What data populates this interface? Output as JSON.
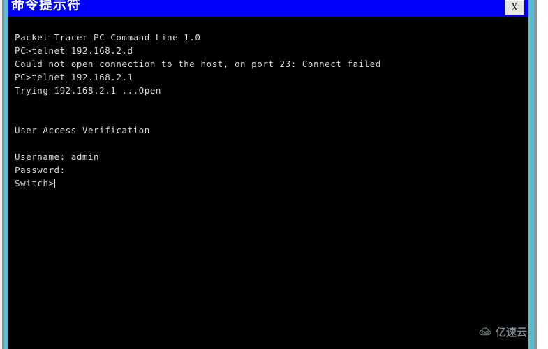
{
  "window": {
    "title": "命令提示符",
    "close_button_label": "X",
    "close_button_icon": "close-icon",
    "titlebar_color": "#0000ff",
    "border_color": "#5bbfd4",
    "console_background": "#000000",
    "console_text_color": "#d8d8d8"
  },
  "console": {
    "lines": [
      "Packet Tracer PC Command Line 1.0",
      "PC>telnet 192.168.2.d",
      "Could not open connection to the host, on port 23: Connect failed",
      "PC>telnet 192.168.2.1",
      "Trying 192.168.2.1 ...Open",
      "",
      "",
      "User Access Verification",
      "",
      "Username: admin",
      "Password:",
      "Switch>"
    ],
    "prompt_line": "Switch>",
    "cursor_visible": true
  },
  "watermark": {
    "text": "亿速云",
    "logo_icon": "cloud-icon",
    "color": "#7e8b93"
  }
}
